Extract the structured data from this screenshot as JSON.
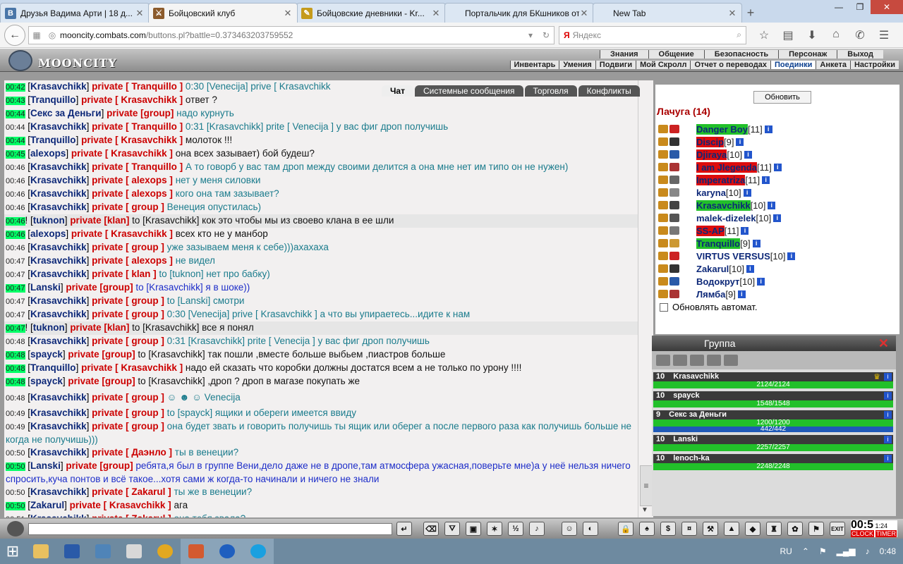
{
  "browser": {
    "tabs": [
      {
        "title": "Друзья Вадима Арти | 18 д...",
        "icon": "vk-icon",
        "fav": "В",
        "color": "#4a76a8",
        "active": false
      },
      {
        "title": "Бойцовский клуб",
        "icon": "swords-icon",
        "fav": "⚔",
        "color": "#8b5a2b",
        "active": true
      },
      {
        "title": "Бойцовские дневники - Kr...",
        "icon": "diary-icon",
        "fav": "✎",
        "color": "#c59b1c",
        "active": false
      },
      {
        "title": "Портальчик для БКшников от...",
        "icon": "portal-icon",
        "fav": "",
        "color": "#dce7f3",
        "active": false
      },
      {
        "title": "New Tab",
        "icon": "newtab-icon",
        "fav": "",
        "color": "#dce7f3",
        "active": false
      }
    ],
    "url_host": "mooncity.combats.com",
    "url_path": "/buttons.pl?battle=0.373463203759552",
    "search_placeholder": "Яндекс",
    "search_brand": "Я"
  },
  "game": {
    "logo": "MOONCITY",
    "menu_top": [
      "Знания",
      "Общение",
      "Безопасность",
      "Персонаж",
      "Выход"
    ],
    "menu_bottom": [
      "Инвентарь",
      "Умения",
      "Подвиги",
      "Мой Скролл",
      "Отчет о переводах",
      "Поединки",
      "Анкета",
      "Настройки"
    ],
    "menu_active": "Поединки"
  },
  "chat": {
    "tabs": [
      "Чат",
      "Системные сообщения",
      "Торговля",
      "Конфликты"
    ],
    "messages": [
      {
        "t": "00:42",
        "g": true,
        "n": "Krasavchikk",
        "p": "private [ Tranquillo ]",
        "x": "0:30 [Venecija] prive [ Krasavchikk"
      },
      {
        "t": "00:43",
        "g": true,
        "n": "Tranquillo",
        "p": "private [ Krasavchikk ]",
        "x": "ответ ?",
        "dark": true
      },
      {
        "t": "00:44",
        "g": true,
        "n": "Секс за Деньги",
        "p": "private [group]",
        "x": "надо курнуть"
      },
      {
        "t": "00:44",
        "g": false,
        "n": "Krasavchikk",
        "p": "private [ Tranquillo ]",
        "x": "0:31 [Krasavchikk] prite [ Venecija ] у вас фиг дроп получишь"
      },
      {
        "t": "00:44",
        "g": true,
        "n": "Tranquillo",
        "p": "private [ Krasavchikk ]",
        "x": "молоток !!!",
        "dark": true
      },
      {
        "t": "00:45",
        "g": true,
        "n": "alexops",
        "p": "private [ Krasavchikk ]",
        "x": "она всех зазывает) бой будеш?",
        "dark": true
      },
      {
        "t": "00:46",
        "g": false,
        "n": "Krasavchikk",
        "p": "private [ Tranquillo ]",
        "x": "А то говорб у вас там дроп между своими делится а она мне нет им типо он не нужен)",
        "wrap": true
      },
      {
        "t": "00:46",
        "g": false,
        "n": "Krasavchikk",
        "p": "private [ alexops ]",
        "x": "нет у меня силовки"
      },
      {
        "t": "00:46",
        "g": false,
        "n": "Krasavchikk",
        "p": "private [ alexops ]",
        "x": "кого она там зазывает?"
      },
      {
        "t": "00:46",
        "g": false,
        "n": "Krasavchikk",
        "p": "private [ group ]",
        "x": "Венеция опустилась)"
      },
      {
        "t": "00:46",
        "g": true,
        "n": "tuknon",
        "p": "private [klan]",
        "x": "to [Krasavchikk] кок это чтобы мы из своево клана в ее шли",
        "dark": true,
        "hl": true,
        "bang": true
      },
      {
        "t": "00:46",
        "g": true,
        "n": "alexops",
        "p": "private [ Krasavchikk ]",
        "x": "всех кто не у манбор",
        "dark": true
      },
      {
        "t": "00:46",
        "g": false,
        "n": "Krasavchikk",
        "p": "private [ group ]",
        "x": "уже зазываем меня к себе)))ахахаха"
      },
      {
        "t": "00:47",
        "g": false,
        "n": "Krasavchikk",
        "p": "private [ alexops ]",
        "x": "не видел"
      },
      {
        "t": "00:47",
        "g": false,
        "n": "Krasavchikk",
        "p": "private [ klan ]",
        "x": "to [tuknon] нет про бабку)"
      },
      {
        "t": "00:47",
        "g": true,
        "n": "Lanski",
        "p": "private [group]",
        "x": "to [Krasavchikk] я в шоке))",
        "blue": true
      },
      {
        "t": "00:47",
        "g": false,
        "n": "Krasavchikk",
        "p": "private [ group ]",
        "x": "to [Lanski] смотри"
      },
      {
        "t": "00:47",
        "g": false,
        "n": "Krasavchikk",
        "p": "private [ group ]",
        "x": "0:30 [Venecija] prive [ Krasavchikk ] а что вы упираетесь...идите к нам"
      },
      {
        "t": "00:47",
        "g": true,
        "n": "tuknon",
        "p": "private [klan]",
        "x": "to [Krasavchikk] все я понял",
        "dark": true,
        "hl": true,
        "bang": true
      },
      {
        "t": "00:48",
        "g": false,
        "n": "Krasavchikk",
        "p": "private [ group ]",
        "x": "0:31 [Krasavchikk] prite [ Venecija ] у вас фиг дроп получишь"
      },
      {
        "t": "00:48",
        "g": true,
        "n": "spayck",
        "p": "private [group]",
        "x": "to [Krasavchikk] так пошли ,вместе больше выбьем ,пиастров больше",
        "dark": true
      },
      {
        "t": "00:48",
        "g": true,
        "n": "Tranquillo",
        "p": "private [ Krasavchikk ]",
        "x": "надо ей сказать что коробки должны достатся всем а не только по урону !!!!",
        "dark": true
      },
      {
        "t": "00:48",
        "g": true,
        "n": "spayck",
        "p": "private [group]",
        "x": "to [Krasavchikk] ,дроп ? дроп в магазе покупать же",
        "dark": true
      },
      {
        "t": "00:48",
        "g": false,
        "n": "Krasavchikk",
        "p": "private [ group ]",
        "x": "☺ ☻ ☺   Venecija",
        "tall": true
      },
      {
        "t": "00:49",
        "g": false,
        "n": "Krasavchikk",
        "p": "private [ group ]",
        "x": "to [spayck] ящики и обереги имеется ввиду"
      },
      {
        "t": "00:49",
        "g": false,
        "n": "Krasavchikk",
        "p": "private [ group ]",
        "x": "она будет звать и говорить получишь ты ящик или оберег а после первого раза как получишь больше не когда не получишь)))",
        "wrap": true
      },
      {
        "t": "00:50",
        "g": false,
        "n": "Krasavchikk",
        "p": "private [ Даэнло ]",
        "x": "ты в венеции?"
      },
      {
        "t": "00:50",
        "g": true,
        "n": "Lanski",
        "p": "private [group]",
        "x": "ребята,я был в группе Вени,дело даже не в дропе,там атмосфера ужасная,поверьте мне)а у неё нельзя ничего спросить,куча понтов и всё такое...хотя сами ж когда-то начинали и ничего не знали",
        "wrap": true,
        "blue": true
      },
      {
        "t": "00:50",
        "g": false,
        "n": "Krasavchikk",
        "p": "private [ Zakarul ]",
        "x": "ты же в венеции?"
      },
      {
        "t": "00:50",
        "g": true,
        "n": "Zakarul",
        "p": "private [ Krasavchikk ]",
        "x": "ага",
        "dark": true
      },
      {
        "t": "00:51",
        "g": false,
        "n": "Krasavchikk",
        "p": "private [ Zakarul ]",
        "x": "она тебя звала?"
      }
    ]
  },
  "location": {
    "refresh_label": "Обновить",
    "title": "Лачуга (14)",
    "auto_label": "Обновлять автомат.",
    "players": [
      {
        "name": "Danger Boy",
        "lvl": "[11]",
        "hl": "green"
      },
      {
        "name": "Discip",
        "lvl": "[9]",
        "hl": "red"
      },
      {
        "name": "Djiraya",
        "lvl": "[10]",
        "hl": "red"
      },
      {
        "name": "I am Jlegenda",
        "lvl": "[11]",
        "hl": "red"
      },
      {
        "name": "Imperatriza",
        "lvl": "[11]",
        "hl": "red"
      },
      {
        "name": "karyna",
        "lvl": "[10]",
        "hl": ""
      },
      {
        "name": "Krasavchikk",
        "lvl": "[10]",
        "hl": "green"
      },
      {
        "name": "malek-dizelek",
        "lvl": "[10]",
        "hl": ""
      },
      {
        "name": "SS-AP",
        "lvl": "[11]",
        "hl": "red"
      },
      {
        "name": "Tranquillo",
        "lvl": "[9]",
        "hl": "green"
      },
      {
        "name": "VIRTUS VERSUS",
        "lvl": "[10]",
        "hl": ""
      },
      {
        "name": "Zakarul",
        "lvl": "[10]",
        "hl": ""
      },
      {
        "name": "Водокрут",
        "lvl": "[10]",
        "hl": ""
      },
      {
        "name": "Лямба",
        "lvl": "[9]",
        "hl": ""
      }
    ]
  },
  "group": {
    "title": "Группа",
    "members": [
      {
        "lvl": "10",
        "name": "Krasavchikk",
        "hp": "2124/2124",
        "leader": true
      },
      {
        "lvl": "10",
        "name": "spayck",
        "hp": "1548/1548"
      },
      {
        "lvl": "9",
        "name": "Секс за Деньги",
        "hp": "1200/1200",
        "mp": "442/442"
      },
      {
        "lvl": "10",
        "name": "Lanski",
        "hp": "2257/2257"
      },
      {
        "lvl": "10",
        "name": "lenoch-ka",
        "hp": "2248/2248"
      }
    ]
  },
  "clock": {
    "time": "00:5",
    "sub": "1:24",
    "labels": [
      "CLOCK",
      "TIMER"
    ],
    "exit": "EXIT"
  },
  "taskbar": {
    "lang": "RU",
    "time": "0:48"
  },
  "colors": {
    "time_green": "#00ff66",
    "name_blue": "#0d2878",
    "private_red": "#cc0000",
    "text_teal": "#1a7b8c",
    "hl_green": "#22c02a",
    "hl_red": "#dd0c0c"
  }
}
